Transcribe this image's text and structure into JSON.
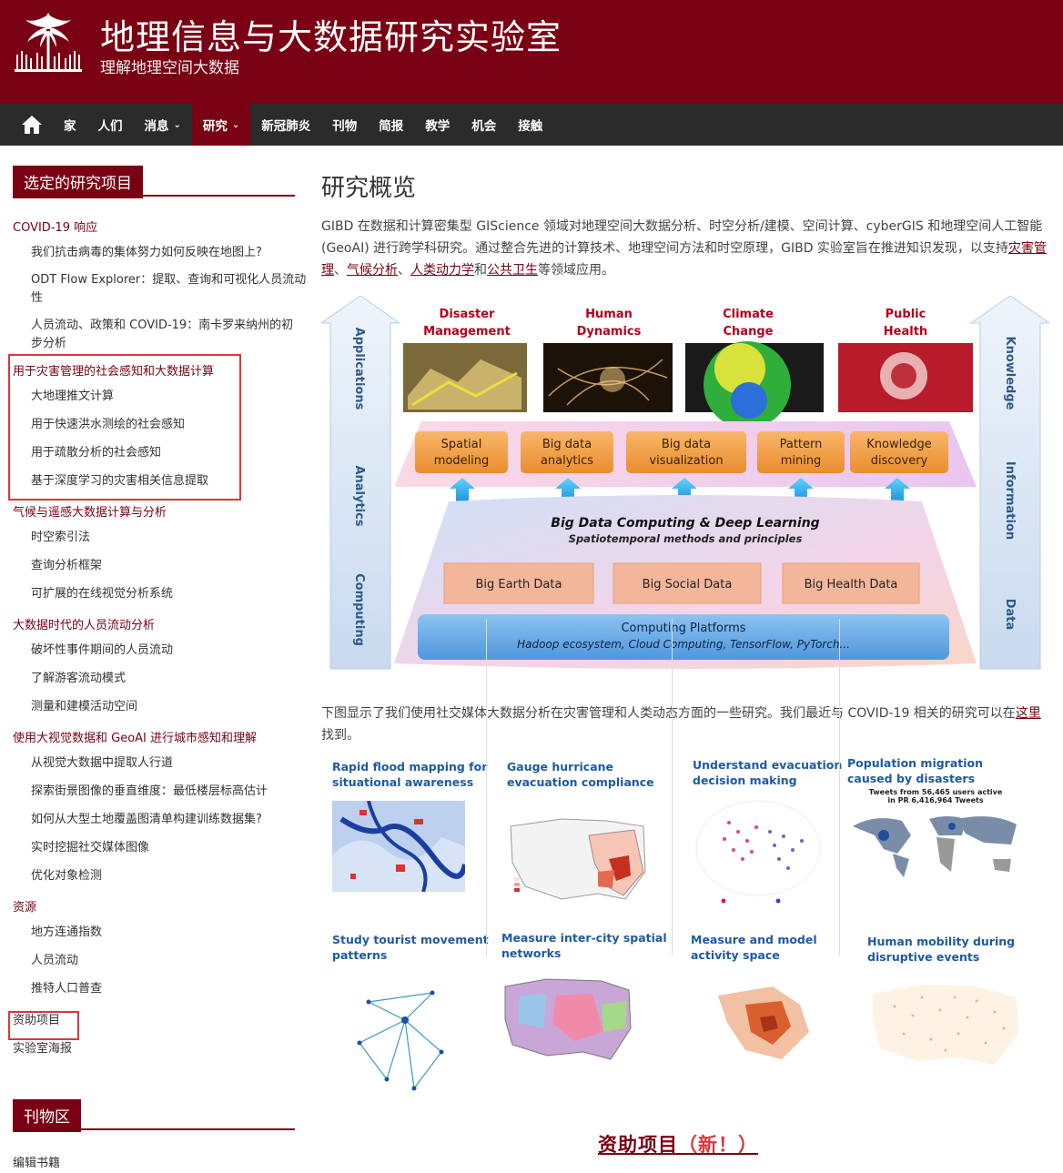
{
  "site": {
    "title": "地理信息与大数据研究实验室",
    "subtitle": "理解地理空间大数据"
  },
  "nav": {
    "items": [
      {
        "label": "家"
      },
      {
        "label": "人们"
      },
      {
        "label": "消息",
        "caret": "⌄"
      },
      {
        "label": "研究",
        "caret": "⌄",
        "active": true
      },
      {
        "label": "新冠肺炎"
      },
      {
        "label": "刊物"
      },
      {
        "label": "简报"
      },
      {
        "label": "教学"
      },
      {
        "label": "机会"
      },
      {
        "label": "接触"
      }
    ]
  },
  "sidebar": {
    "title": "选定的研究项目",
    "groups": [
      {
        "label": "COVID-19 响应",
        "items": [
          "我们抗击病毒的集体努力如何反映在地图上?",
          "ODT Flow Explorer：提取、查询和可视化人员流动性",
          "人员流动、政策和 COVID-19：南卡罗来纳州的初步分析"
        ]
      },
      {
        "label": "用于灾害管理的社会感知和大数据计算",
        "items": [
          "大地理推文计算",
          "用于快速洪水测绘的社会感知",
          "用于疏散分析的社会感知",
          "基于深度学习的灾害相关信息提取"
        ]
      },
      {
        "label": "气候与遥感大数据计算与分析",
        "items": [
          "时空索引法",
          "查询分析框架",
          "可扩展的在线视觉分析系统"
        ]
      },
      {
        "label": "大数据时代的人员流动分析",
        "items": [
          "破坏性事件期间的人员流动",
          "了解游客流动模式",
          "测量和建模活动空间"
        ]
      },
      {
        "label": "使用大视觉数据和 GeoAI 进行城市感知和理解",
        "items": [
          "从视觉大数据中提取人行道",
          "探索街景图像的垂直维度：最低楼层标高估计",
          "如何从大型土地覆盖图清单构建训练数据集?",
          "实时挖掘社交媒体图像",
          "优化对象检测"
        ]
      },
      {
        "label": "资源",
        "items": [
          "地方连通指数",
          "人员流动",
          "推特人口普查"
        ]
      },
      {
        "label": "资助项目",
        "items": []
      },
      {
        "label": "实验室海报",
        "items": []
      }
    ],
    "pubs_title": "刊物区",
    "pubs_item": "编辑书籍"
  },
  "main": {
    "title": "研究概览",
    "intro_1": "GIBD 在数据和计算密集型 GIScience 领域对地理空间大数据分析、时空分析/建模、空间计算、cyberGIS 和地理空间人工智能 (GeoAI) 进行跨学科研究。通过整合先进的计算技术、地理空间方法和时空原理，GIBD 实验室旨在推进知识发现，以支持",
    "link_disaster": "灾害管理",
    "sep1": "、",
    "link_climate": "气候分析",
    "sep2": "、",
    "link_human": "人类动力学",
    "sep3": "和",
    "link_health": "公共卫生",
    "intro_2": "等领域应用。",
    "para2_a": "下图显示了我们使用社交媒体大数据分析在灾害管理和人类动态方面的一些研究。我们最近与 COVID-19 相关的研究可以在",
    "para2_link": "这里",
    "para2_b": "找到。",
    "funded": "资助项目",
    "funded_new": "（新！）"
  },
  "diagram": {
    "left_arrow": [
      "Applications",
      "Analytics",
      "Computing"
    ],
    "right_arrow": [
      "Knowledge",
      "Information",
      "Data"
    ],
    "domains": [
      "Disaster Management",
      "Human Dynamics",
      "Climate Change",
      "Public Health"
    ],
    "analytics": [
      "Spatial modeling",
      "Big data analytics",
      "Big data visualization",
      "Pattern mining",
      "Knowledge discovery"
    ],
    "core_title": "Big Data Computing & Deep Learning",
    "core_sub": "Spatiotemporal methods and principles",
    "data_boxes": [
      "Big Earth Data",
      "Big Social Data",
      "Big Health Data"
    ],
    "platform_title": "Computing Platforms",
    "platform_sub": "Hadoop ecosystem, Cloud Computing, TensorFlow, PyTorch..."
  },
  "cells": [
    {
      "title": "Rapid flood mapping for situational awareness"
    },
    {
      "title": "Gauge hurricane evacuation compliance"
    },
    {
      "title": "Understand evacuation decision making"
    },
    {
      "title": "Population migration caused by disasters",
      "sub": "Tweets from 56,465 users active in PR 6,416,964 Tweets"
    },
    {
      "title": "Study tourist movement patterns"
    },
    {
      "title": "Measure inter-city spatial networks"
    },
    {
      "title": "Measure and model activity space"
    },
    {
      "title": "Human mobility during disruptive events"
    }
  ],
  "colors": {
    "brand": "#7a0013",
    "nav": "#2b2b2b",
    "highlight": "#d9363e",
    "cell_title": "#1f5aa0"
  }
}
